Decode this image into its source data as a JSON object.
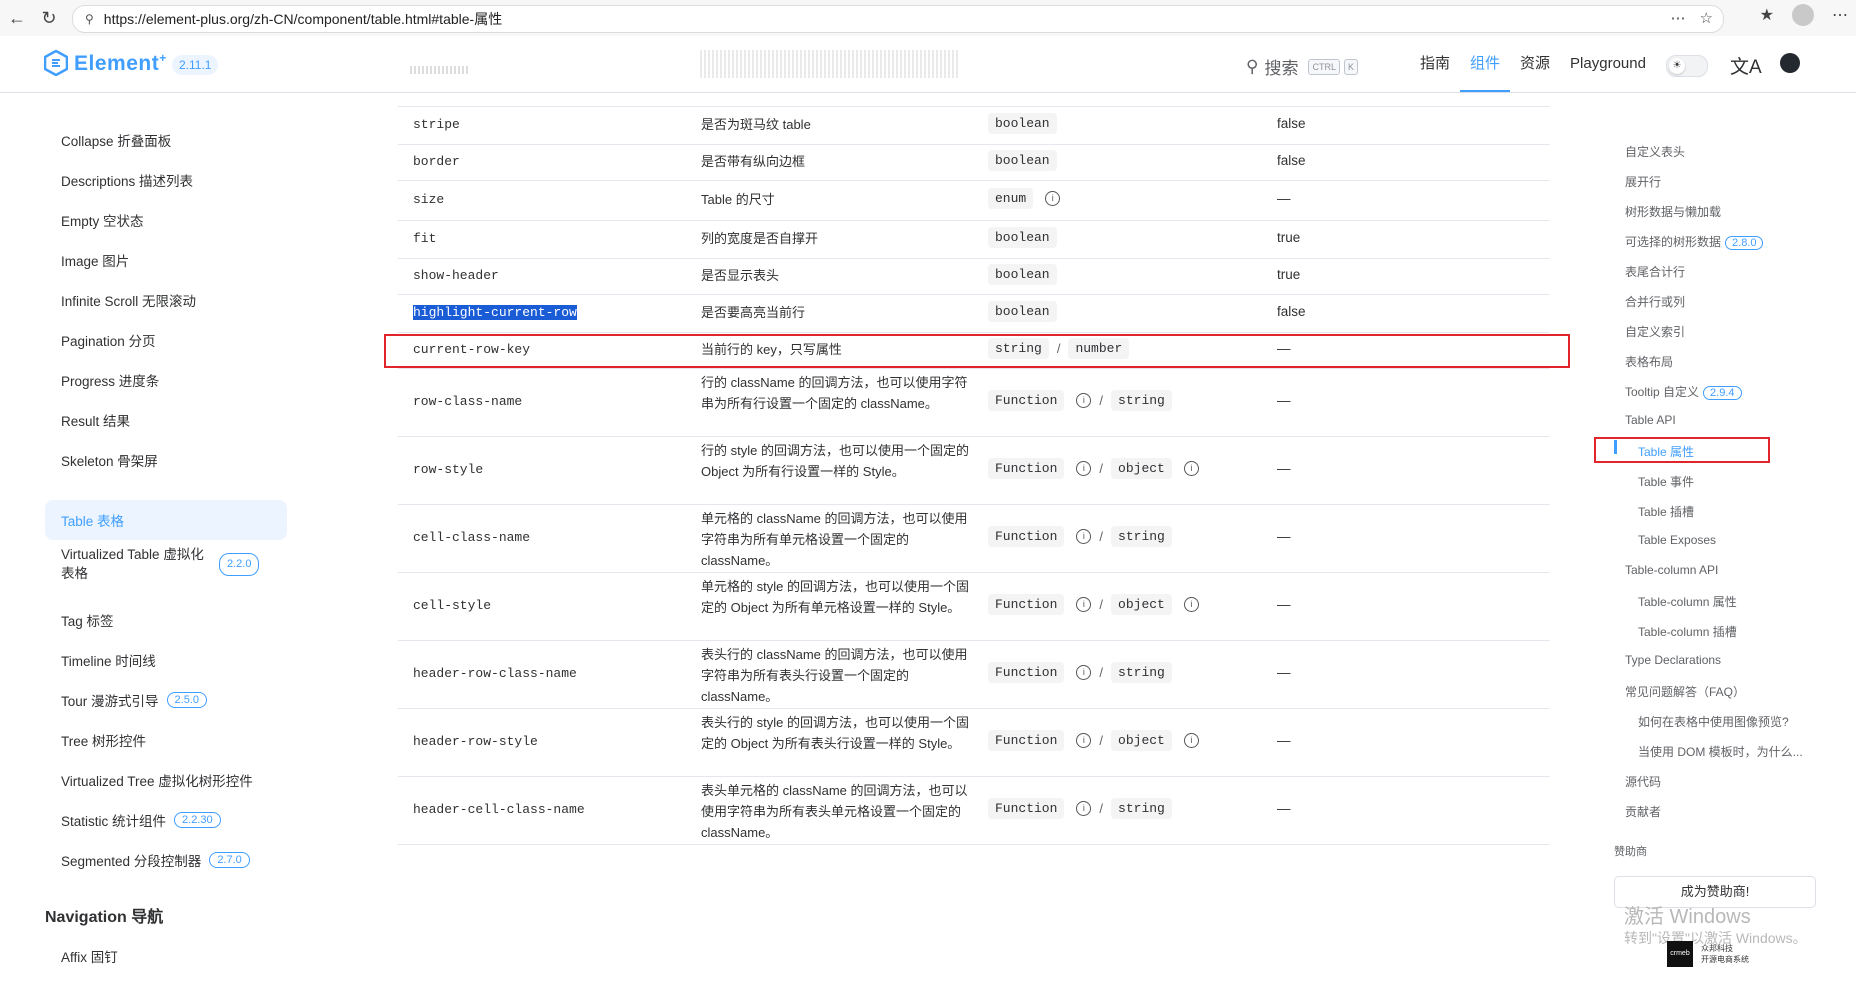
{
  "browser": {
    "url": "https://element-plus.org/zh-CN/component/table.html#table-属性"
  },
  "header": {
    "logo_text": "Element",
    "logo_sup": "+",
    "version": "2.11.1",
    "search_label": "搜索",
    "kbd_ctrl": "CTRL",
    "kbd_k": "K",
    "nav": [
      "指南",
      "组件",
      "资源",
      "Playground"
    ]
  },
  "sidebar": {
    "items": [
      {
        "label": "Collapse 折叠面板",
        "badge": ""
      },
      {
        "label": "Descriptions 描述列表",
        "badge": ""
      },
      {
        "label": "Empty 空状态",
        "badge": ""
      },
      {
        "label": "Image 图片",
        "badge": ""
      },
      {
        "label": "Infinite Scroll 无限滚动",
        "badge": ""
      },
      {
        "label": "Pagination 分页",
        "badge": ""
      },
      {
        "label": "Progress 进度条",
        "badge": ""
      },
      {
        "label": "Result 结果",
        "badge": ""
      },
      {
        "label": "Skeleton 骨架屏",
        "badge": ""
      },
      {
        "label": "Table 表格",
        "badge": ""
      },
      {
        "label": "Virtualized Table 虚拟化表格",
        "badge": "2.2.0"
      },
      {
        "label": "Tag 标签",
        "badge": ""
      },
      {
        "label": "Timeline 时间线",
        "badge": ""
      },
      {
        "label": "Tour 漫游式引导",
        "badge": "2.5.0"
      },
      {
        "label": "Tree 树形控件",
        "badge": ""
      },
      {
        "label": "Virtualized Tree 虚拟化树形控件",
        "badge": ""
      },
      {
        "label": "Statistic 统计组件",
        "badge": "2.2.30"
      },
      {
        "label": "Segmented 分段控制器",
        "badge": "2.7.0"
      }
    ],
    "group_title": "Navigation 导航",
    "group_item": "Affix 固钉"
  },
  "table": {
    "rows": [
      {
        "name": "stripe",
        "desc": "是否为斑马纹 table",
        "types": [
          "boolean"
        ],
        "info": [
          false
        ],
        "default": "false"
      },
      {
        "name": "border",
        "desc": "是否带有纵向边框",
        "types": [
          "boolean"
        ],
        "info": [
          false
        ],
        "default": "false"
      },
      {
        "name": "size",
        "desc": "Table 的尺寸",
        "types": [
          "enum"
        ],
        "info": [
          true
        ],
        "default": "—"
      },
      {
        "name": "fit",
        "desc": "列的宽度是否自撑开",
        "types": [
          "boolean"
        ],
        "info": [
          false
        ],
        "default": "true"
      },
      {
        "name": "show-header",
        "desc": "是否显示表头",
        "types": [
          "boolean"
        ],
        "info": [
          false
        ],
        "default": "true"
      },
      {
        "name": "highlight-current-row",
        "desc": "是否要高亮当前行",
        "types": [
          "boolean"
        ],
        "info": [
          false
        ],
        "default": "false"
      },
      {
        "name": "current-row-key",
        "desc": "当前行的 key，只写属性",
        "types": [
          "string",
          "number"
        ],
        "info": [
          false,
          false
        ],
        "default": "—"
      },
      {
        "name": "row-class-name",
        "desc": "行的 className 的回调方法，也可以使用字符串为所有行设置一个固定的 className。",
        "types": [
          "Function",
          "string"
        ],
        "info": [
          true,
          false
        ],
        "default": "—"
      },
      {
        "name": "row-style",
        "desc": "行的 style 的回调方法，也可以使用一个固定的 Object 为所有行设置一样的 Style。",
        "types": [
          "Function",
          "object"
        ],
        "info": [
          true,
          true
        ],
        "default": "—"
      },
      {
        "name": "cell-class-name",
        "desc": "单元格的 className 的回调方法，也可以使用字符串为所有单元格设置一个固定的 className。",
        "types": [
          "Function",
          "string"
        ],
        "info": [
          true,
          false
        ],
        "default": "—"
      },
      {
        "name": "cell-style",
        "desc": "单元格的 style 的回调方法，也可以使用一个固定的 Object 为所有单元格设置一样的 Style。",
        "types": [
          "Function",
          "object"
        ],
        "info": [
          true,
          true
        ],
        "default": "—"
      },
      {
        "name": "header-row-class-name",
        "desc": "表头行的 className 的回调方法，也可以使用字符串为所有表头行设置一个固定的 className。",
        "types": [
          "Function",
          "string"
        ],
        "info": [
          true,
          false
        ],
        "default": "—"
      },
      {
        "name": "header-row-style",
        "desc": "表头行的 style 的回调方法，也可以使用一个固定的 Object 为所有表头行设置一样的 Style。",
        "types": [
          "Function",
          "object"
        ],
        "info": [
          true,
          true
        ],
        "default": "—"
      },
      {
        "name": "header-cell-class-name",
        "desc": "表头单元格的 className 的回调方法，也可以使用字符串为所有表头单元格设置一个固定的 className。",
        "types": [
          "Function",
          "string"
        ],
        "info": [
          true,
          false
        ],
        "default": "—"
      }
    ]
  },
  "toc": {
    "items": [
      {
        "label": "自定义表头",
        "badge": "",
        "level": 1
      },
      {
        "label": "展开行",
        "badge": "",
        "level": 1
      },
      {
        "label": "树形数据与懒加载",
        "badge": "",
        "level": 1
      },
      {
        "label": "可选择的树形数据",
        "badge": "2.8.0",
        "level": 1
      },
      {
        "label": "表尾合计行",
        "badge": "",
        "level": 1
      },
      {
        "label": "合并行或列",
        "badge": "",
        "level": 1
      },
      {
        "label": "自定义索引",
        "badge": "",
        "level": 1
      },
      {
        "label": "表格布局",
        "badge": "",
        "level": 1
      },
      {
        "label": "Tooltip 自定义",
        "badge": "2.9.4",
        "level": 1
      },
      {
        "label": "Table API",
        "badge": "",
        "level": 1
      },
      {
        "label": "Table 属性",
        "badge": "",
        "level": 2
      },
      {
        "label": "Table 事件",
        "badge": "",
        "level": 2
      },
      {
        "label": "Table 插槽",
        "badge": "",
        "level": 2
      },
      {
        "label": "Table Exposes",
        "badge": "",
        "level": 2
      },
      {
        "label": "Table-column API",
        "badge": "",
        "level": 1
      },
      {
        "label": "Table-column 属性",
        "badge": "",
        "level": 2
      },
      {
        "label": "Table-column 插槽",
        "badge": "",
        "level": 2
      },
      {
        "label": "Type Declarations",
        "badge": "",
        "level": 1
      },
      {
        "label": "常见问题解答（FAQ）",
        "badge": "",
        "level": 1
      },
      {
        "label": "如何在表格中使用图像预览?",
        "badge": "",
        "level": 2
      },
      {
        "label": "当使用 DOM 模板时，为什么...",
        "badge": "",
        "level": 2
      },
      {
        "label": "源代码",
        "badge": "",
        "level": 1
      },
      {
        "label": "贡献者",
        "badge": "",
        "level": 1
      }
    ],
    "sponsor_label": "赞助商",
    "sponsor_button": "成为赞助商!"
  },
  "watermark": {
    "line1": "激活 Windows",
    "line2": "转到\"设置\"以激活 Windows。"
  },
  "sponsor_logo": {
    "mark": "crmeb",
    "name": "众邦科技",
    "tag": "开源电商系统"
  },
  "colors": {
    "accent": "#409eff",
    "highlight_box": "#e0262b"
  }
}
